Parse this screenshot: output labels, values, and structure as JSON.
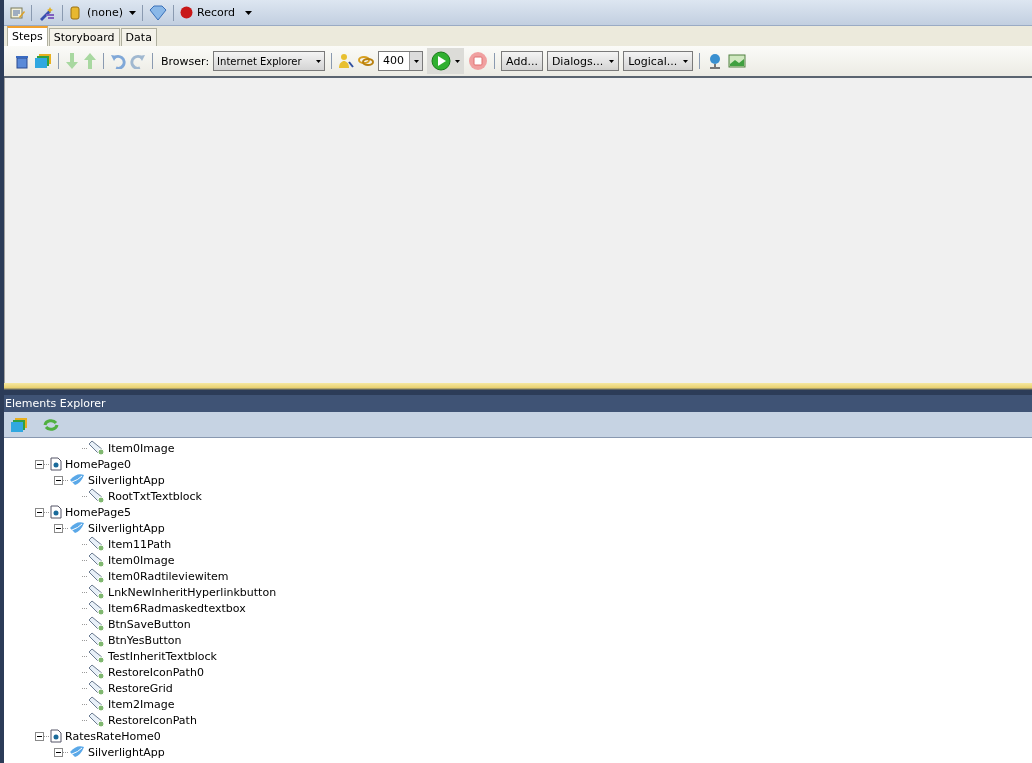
{
  "top_toolbar": {
    "project": "(none)",
    "record": "Record"
  },
  "tabs": [
    {
      "label": "Steps",
      "selected": true
    },
    {
      "label": "Storyboard",
      "selected": false
    },
    {
      "label": "Data",
      "selected": false
    }
  ],
  "steps_toolbar": {
    "browser_label": "Browser:",
    "browser": "Internet Explorer",
    "speed": "400",
    "buttons": [
      {
        "label": "Add...",
        "dropdown": false
      },
      {
        "label": "Dialogs...",
        "dropdown": true
      },
      {
        "label": "Logical...",
        "dropdown": true
      }
    ]
  },
  "elements_explorer": {
    "title": "Elements Explorer",
    "nodes": [
      {
        "children": [
          {
            "children": [
              {
                "label": "Item0Image",
                "kind": "element"
              }
            ]
          }
        ]
      },
      {
        "label": "HomePage0",
        "kind": "page",
        "expanded": true,
        "children": [
          {
            "label": "SilverlightApp",
            "kind": "app",
            "expanded": true,
            "children": [
              {
                "label": "RootTxtTextblock",
                "kind": "element"
              }
            ]
          }
        ]
      },
      {
        "label": "HomePage5",
        "kind": "page",
        "expanded": true,
        "children": [
          {
            "label": "SilverlightApp",
            "kind": "app",
            "expanded": true,
            "children": [
              {
                "label": "Item11Path",
                "kind": "element"
              },
              {
                "label": "Item0Image",
                "kind": "element"
              },
              {
                "label": "Item0Radtileviewitem",
                "kind": "element"
              },
              {
                "label": "LnkNewInheritHyperlinkbutton",
                "kind": "element"
              },
              {
                "label": "Item6Radmaskedtextbox",
                "kind": "element"
              },
              {
                "label": "BtnSaveButton",
                "kind": "element"
              },
              {
                "label": "BtnYesButton",
                "kind": "element"
              },
              {
                "label": "TestInheritTextblock",
                "kind": "element"
              },
              {
                "label": "RestoreIconPath0",
                "kind": "element"
              },
              {
                "label": "RestoreGrid",
                "kind": "element"
              },
              {
                "label": "Item2Image",
                "kind": "element"
              },
              {
                "label": "RestoreIconPath",
                "kind": "element"
              }
            ]
          }
        ]
      },
      {
        "label": "RatesRateHome0",
        "kind": "page",
        "expanded": true,
        "children": [
          {
            "label": "SilverlightApp",
            "kind": "app",
            "expanded": true
          }
        ]
      }
    ]
  }
}
